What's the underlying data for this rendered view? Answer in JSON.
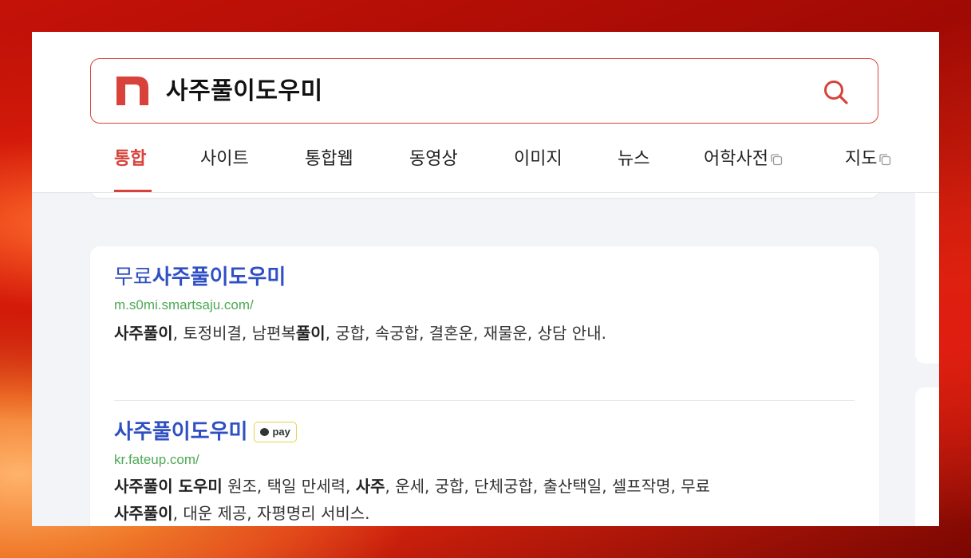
{
  "search": {
    "query": "사주풀이도우미"
  },
  "tabs": [
    {
      "label": "통합"
    },
    {
      "label": "사이트"
    },
    {
      "label": "통합웹"
    },
    {
      "label": "동영상"
    },
    {
      "label": "이미지"
    },
    {
      "label": "뉴스"
    },
    {
      "label": "어학사전"
    },
    {
      "label": "지도"
    }
  ],
  "colors": {
    "accent": "#d8423a",
    "title_link": "#2f4fc2",
    "url": "#4caa54"
  },
  "results": [
    {
      "title_prefix": "무료",
      "title_bold": "사주풀이도우미",
      "url": "m.s0mi.smartsaju.com/",
      "desc": [
        {
          "text": "사주풀이",
          "bold": true
        },
        {
          "text": ", 토정비결, 남편복",
          "bold": false
        },
        {
          "text": "풀이",
          "bold": true
        },
        {
          "text": ", 궁합, 속궁합, 결혼운, 재물운, 상담 안내.",
          "bold": false
        }
      ]
    },
    {
      "title_bold": "사주풀이도우미",
      "badge": "pay",
      "url": "kr.fateup.com/",
      "desc_line1": [
        {
          "text": "사주풀이 도우미",
          "bold": true
        },
        {
          "text": " 원조, 택일 만세력, ",
          "bold": false
        },
        {
          "text": "사주",
          "bold": true
        },
        {
          "text": ", 운세, 궁합, 단체궁합, 출산택일, 셀프작명, 무료",
          "bold": false
        }
      ],
      "desc_line2": [
        {
          "text": "사주풀이",
          "bold": true
        },
        {
          "text": ", 대운 제공, 자평명리 서비스.",
          "bold": false
        }
      ]
    }
  ]
}
